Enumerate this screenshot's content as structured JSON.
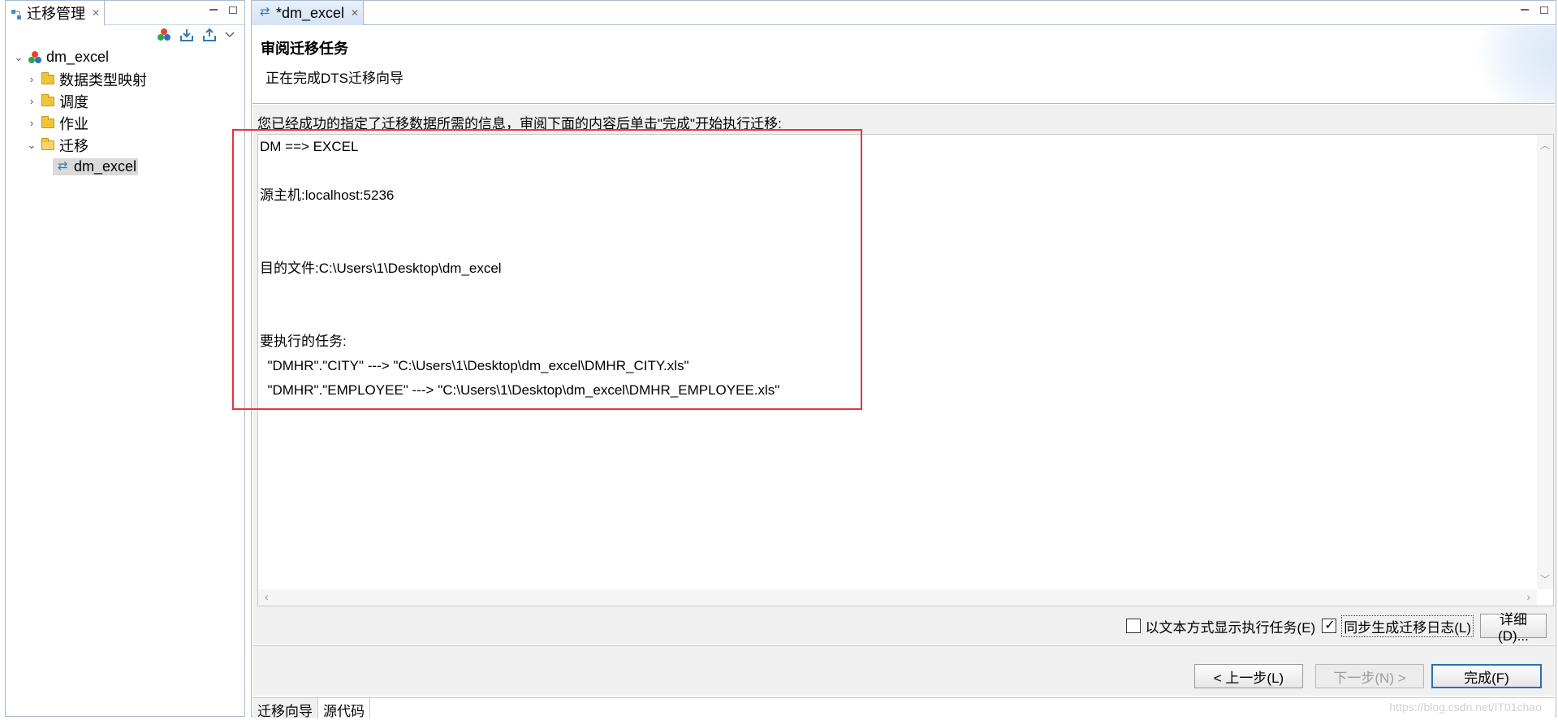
{
  "left_view": {
    "tab_title": "迁移管理",
    "tree": {
      "root": "dm_excel",
      "children": [
        {
          "label": "数据类型映射",
          "expanded": false
        },
        {
          "label": "调度",
          "expanded": false
        },
        {
          "label": "作业",
          "expanded": false
        },
        {
          "label": "迁移",
          "expanded": true,
          "children": [
            "dm_excel"
          ]
        }
      ]
    }
  },
  "editor": {
    "tab_title": "*dm_excel",
    "wizard": {
      "title": "审阅迁移任务",
      "subtitle": "正在完成DTS迁移向导",
      "intro": "您已经成功的指定了迁移数据所需的信息，审阅下面的内容后单击\"完成\"开始执行迁移:",
      "summary": {
        "line1": "DM ==> EXCEL",
        "line2": "源主机:localhost:5236",
        "line3": "目的文件:C:\\Users\\1\\Desktop\\dm_excel",
        "line4": "要执行的任务:",
        "task1": "  \"DMHR\".\"CITY\" ---> \"C:\\Users\\1\\Desktop\\dm_excel\\DMHR_CITY.xls\"",
        "task2": "  \"DMHR\".\"EMPLOYEE\" ---> \"C:\\Users\\1\\Desktop\\dm_excel\\DMHR_EMPLOYEE.xls\""
      },
      "options": {
        "show_as_text_label": "以文本方式显示执行任务(E)",
        "show_as_text_checked": false,
        "sync_log_label": "同步生成迁移日志(L)",
        "sync_log_checked": true,
        "detail_button": "详细(D)..."
      },
      "buttons": {
        "prev": "< 上一步(L)",
        "next": "下一步(N) >",
        "finish": "完成(F)"
      }
    },
    "bottom_tabs": [
      "迁移向导",
      "源代码"
    ]
  },
  "watermark": "https://blog.csdn.net/IT01chao"
}
